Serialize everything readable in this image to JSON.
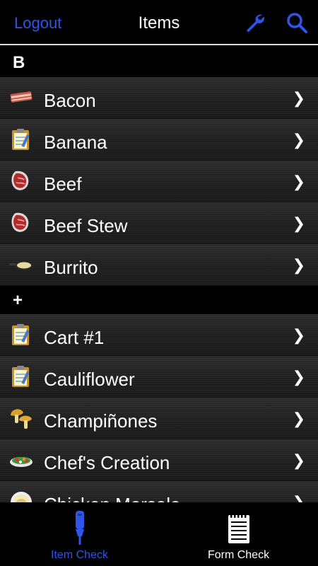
{
  "header": {
    "logout_label": "Logout",
    "title": "Items",
    "settings_icon": "wrench-icon",
    "search_icon": "search-icon",
    "accent_color": "#2f55e8"
  },
  "sections": [
    {
      "label": "B",
      "items": [
        {
          "label": "Bacon",
          "icon": "bacon-icon"
        },
        {
          "label": "Banana",
          "icon": "clipboard-icon"
        },
        {
          "label": "Beef",
          "icon": "meat-icon"
        },
        {
          "label": "Beef Stew",
          "icon": "meat-icon"
        },
        {
          "label": "Burrito",
          "icon": "frying-pan-icon"
        }
      ]
    },
    {
      "label": "+",
      "items": [
        {
          "label": "Cart #1",
          "icon": "clipboard-icon"
        },
        {
          "label": "Cauliflower",
          "icon": "clipboard-icon"
        },
        {
          "label": "Champiñones",
          "icon": "mushroom-icon"
        },
        {
          "label": "Chef's Creation",
          "icon": "salad-icon"
        },
        {
          "label": "Chicken Marsala",
          "icon": "plate-icon"
        }
      ]
    }
  ],
  "chevron": "❯",
  "tabs": [
    {
      "label": "Item Check",
      "icon": "thermometer-probe-icon",
      "active": true
    },
    {
      "label": "Form Check",
      "icon": "notepad-icon",
      "active": false
    }
  ]
}
